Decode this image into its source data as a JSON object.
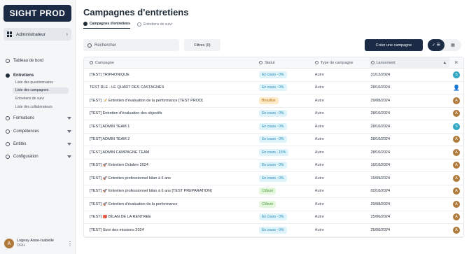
{
  "sidebar": {
    "logo": "SIGHT PROD",
    "role": "Administrateur",
    "items": [
      {
        "label": "Tableau de bord"
      },
      {
        "label": "Entretiens"
      },
      {
        "label": "Formations"
      },
      {
        "label": "Compétences"
      },
      {
        "label": "Entités"
      },
      {
        "label": "Configuration"
      }
    ],
    "subitems": [
      {
        "label": "Liste des questionnaires"
      },
      {
        "label": "Liste des campagnes"
      },
      {
        "label": "Entretiens de suivi"
      },
      {
        "label": "Liste des collaborateurs"
      }
    ],
    "user": {
      "initial": "A",
      "name": "Logeay Anne-Isabelle",
      "role": "DRH"
    }
  },
  "header": {
    "title": "Campagnes d'entretiens",
    "tabs": [
      {
        "label": "Campagnes d'entretiens"
      },
      {
        "label": "Entretiens de suivi"
      }
    ]
  },
  "toolbar": {
    "search_placeholder": "Rechercher",
    "filters_label": "Filtres (0)",
    "create_label": "Créer une campagne"
  },
  "table": {
    "columns": [
      "Campagne",
      "Statut",
      "Type de campagne",
      "Lancement",
      "R"
    ],
    "rows": [
      {
        "name": "[TEST] TRIPHONIQUE",
        "status": "En cours - 0%",
        "status_kind": "blue",
        "type": "Autre",
        "launch": "31/12/2024",
        "owner": "S"
      },
      {
        "name": "TEST RLE - LE QUART DES CASTAGNES",
        "status": "En cours - 0%",
        "status_kind": "blue",
        "type": "Autre",
        "launch": "28/10/2024",
        "owner": "P"
      },
      {
        "name": "[TEST] 📝 Entretien d'évaluation de la performance [TEST PROD]",
        "status": "Brouillon",
        "status_kind": "orange",
        "type": "Autre",
        "launch": "29/08/2024",
        "owner": "A"
      },
      {
        "name": "[TEST] Entretien d'évaluation des objectifs",
        "status": "En cours - 0%",
        "status_kind": "blue",
        "type": "Autre",
        "launch": "28/10/2024",
        "owner": "A"
      },
      {
        "name": "[TEST] ADMIN TEAM 1",
        "status": "En cours - 0%",
        "status_kind": "blue",
        "type": "Autre",
        "launch": "28/10/2024",
        "owner": "S"
      },
      {
        "name": "[TEST] ADMIN TEAM 2",
        "status": "En cours - 0%",
        "status_kind": "blue",
        "type": "Autre",
        "launch": "28/10/2024",
        "owner": "A"
      },
      {
        "name": "[TEST] ADMIN CAMPAGNE TEAM",
        "status": "En cours - 15%",
        "status_kind": "blue",
        "type": "Autre",
        "launch": "28/10/2024",
        "owner": "A"
      },
      {
        "name": "[TEST] 🚀 Entretien Octobre 2024",
        "status": "En cours - 0%",
        "status_kind": "blue",
        "type": "Autre",
        "launch": "16/10/2024",
        "owner": "A"
      },
      {
        "name": "[TEST] 🚀 Entretien professionnel bilan à 6 ans",
        "status": "En cours - 0%",
        "status_kind": "blue",
        "type": "Autre",
        "launch": "15/09/2024",
        "owner": "A"
      },
      {
        "name": "[TEST] 🚀 Entretien professionnel bilan à 6 ans [TEST PRÉPARATION]",
        "status": "Clôturé",
        "status_kind": "green",
        "type": "Autre",
        "launch": "02/10/2024",
        "owner": "A"
      },
      {
        "name": "[TEST] 🚀 Entretien d'évaluation de la performance",
        "status": "Clôturé",
        "status_kind": "green",
        "type": "Autre",
        "launch": "29/08/2024",
        "owner": "A"
      },
      {
        "name": "[TEST] 🎒 BILAN DE LA RENTRÉE",
        "status": "En cours - 0%",
        "status_kind": "blue",
        "type": "Autre",
        "launch": "25/06/2024",
        "owner": "A"
      },
      {
        "name": "[TEST] Suivi des missions 2024",
        "status": "En cours - 0%",
        "status_kind": "blue",
        "type": "Autre",
        "launch": "25/06/2024",
        "owner": "A"
      }
    ]
  }
}
